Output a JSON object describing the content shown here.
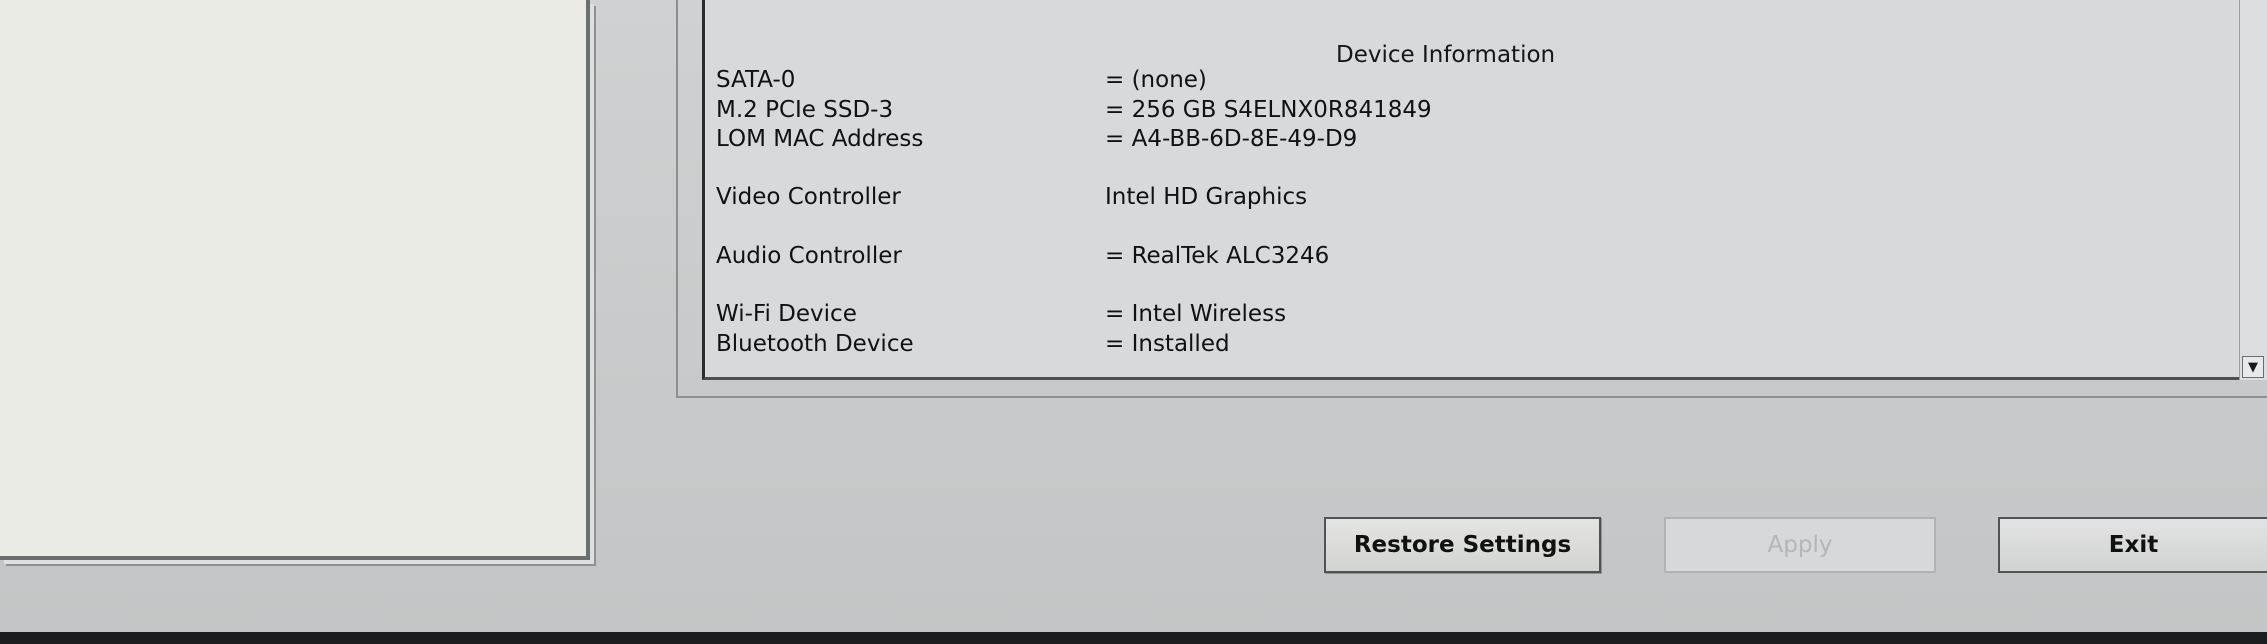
{
  "device_info": {
    "title": "Device Information",
    "rows": [
      {
        "label": "SATA-0",
        "value": "= (none)"
      },
      {
        "label": "M.2 PCIe SSD-3",
        "value": "= 256 GB S4ELNX0R841849"
      },
      {
        "label": "LOM MAC Address",
        "value": "= A4-BB-6D-8E-49-D9"
      },
      {
        "label": "Video Controller",
        "value": "Intel HD Graphics"
      },
      {
        "label": "Audio Controller",
        "value": "= RealTek ALC3246"
      },
      {
        "label": "Wi-Fi Device",
        "value": "= Intel Wireless"
      },
      {
        "label": "Bluetooth Device",
        "value": "= Installed"
      }
    ]
  },
  "buttons": {
    "restore_label": "Restore Settings",
    "apply_label": "Apply",
    "exit_label": "Exit"
  },
  "icons": {
    "scroll_down": "arrow-down-icon"
  }
}
